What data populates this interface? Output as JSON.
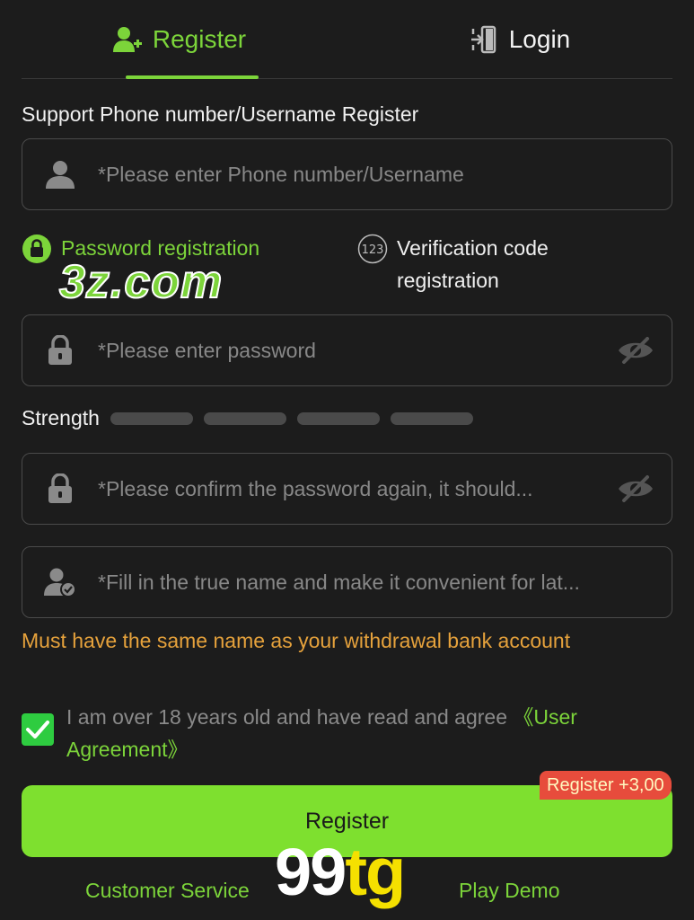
{
  "tabs": {
    "register": "Register",
    "login": "Login"
  },
  "form": {
    "section_label": "Support Phone number/Username Register",
    "username": {
      "placeholder": "*Please enter Phone number/Username",
      "value": ""
    },
    "modes": {
      "password": "Password registration",
      "verification": "Verification code registration",
      "verification_icon_text": "123"
    },
    "password": {
      "placeholder": "*Please enter password",
      "value": ""
    },
    "strength": {
      "label": "Strength",
      "level": 0
    },
    "confirm_password": {
      "placeholder": "*Please confirm the password again, it should...",
      "value": ""
    },
    "real_name": {
      "placeholder": "*Fill in the true name and make it convenient for lat...",
      "value": ""
    },
    "name_note": "Must have the same name as your withdrawal bank account",
    "agreement": {
      "checked": true,
      "text": "I am over 18 years old and have read and agree ",
      "link": "《User Agreement》"
    },
    "register_button": "Register",
    "bonus_badge": "Register +3,00"
  },
  "footer": {
    "customer_service": "Customer Service",
    "play_demo": "Play Demo"
  },
  "overlays": {
    "watermark": "3z.com",
    "brand_part1": "99",
    "brand_part2": "tg"
  },
  "colors": {
    "accent": "#7cd43a",
    "button": "#7ee02f",
    "warning": "#e6a23c",
    "badge": "#e74c3c",
    "required": "#d93a3a"
  },
  "icons": {
    "register_tab": "user-plus-icon",
    "login_tab": "login-door-icon",
    "username": "user-icon",
    "password_mode": "lock-badge-icon",
    "verification_mode": "numeric-123-icon",
    "password": "lock-icon",
    "visibility": "eye-off-icon",
    "real_name": "user-check-icon",
    "checkbox": "checkmark-icon"
  }
}
